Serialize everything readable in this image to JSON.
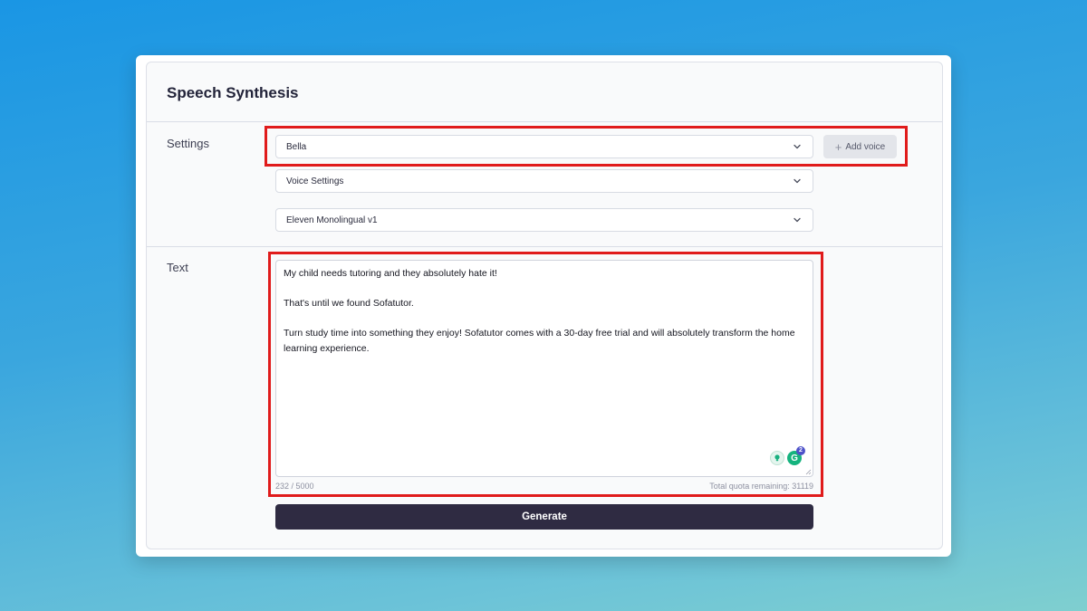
{
  "header": {
    "title": "Speech Synthesis"
  },
  "settings": {
    "label": "Settings",
    "voice_select": "Bella",
    "add_voice_label": "Add voice",
    "voice_settings_select": "Voice Settings",
    "model_select": "Eleven Monolingual v1"
  },
  "text_section": {
    "label": "Text",
    "lines": [
      "My child needs tutoring and they absolutely hate it!",
      "",
      "That's until we found Sofatutor.",
      "",
      "Turn study time into something they enjoy! Sofatutor comes with a 30-day free trial and will absolutely transform the home learning experience."
    ],
    "char_count": "232 / 5000",
    "quota": "Total quota remaining: 31119",
    "grammarly_badge": "2"
  },
  "generate_label": "Generate",
  "icons": {
    "chevron": "chevron-down-icon",
    "plus": "plus-icon",
    "bulb": "lightbulb-icon",
    "grammarly": "grammarly-icon"
  },
  "colors": {
    "highlight": "#e01b1b",
    "generate_bg": "#2f2b42",
    "grammarly": "#15b37e"
  }
}
